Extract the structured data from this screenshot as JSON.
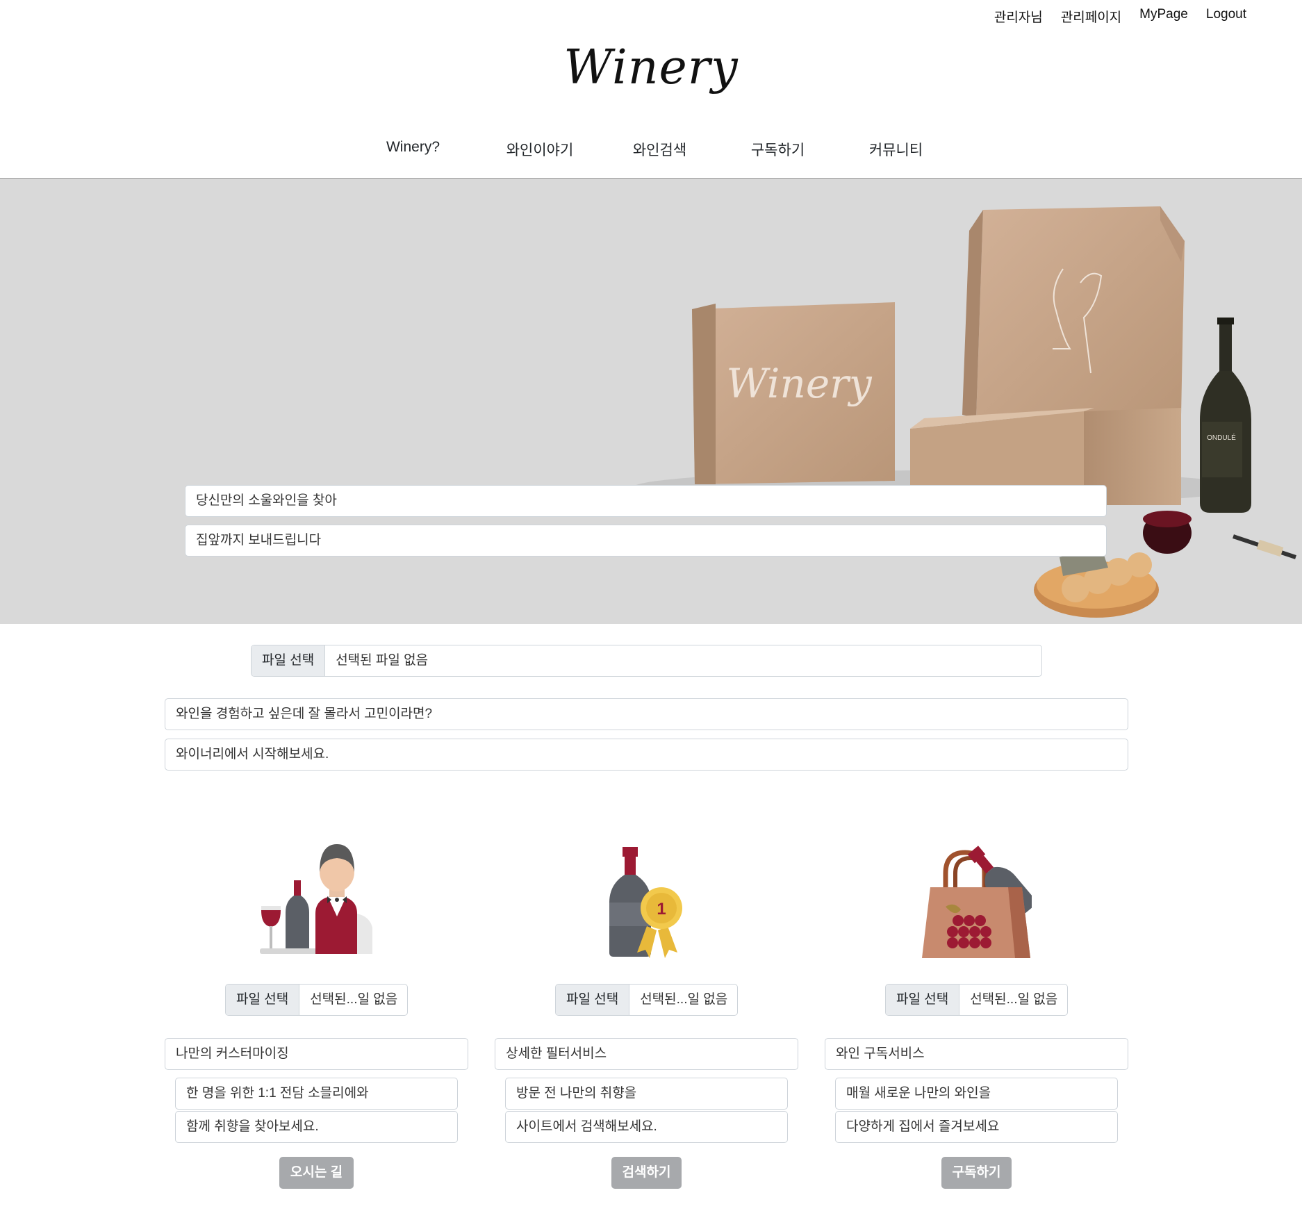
{
  "topbar": {
    "user": "관리자님",
    "admin": "관리페이지",
    "mypage": "MyPage",
    "logout": "Logout"
  },
  "logo": {
    "text": "Winery"
  },
  "nav": {
    "items": [
      "Winery?",
      "와인이야기",
      "와인검색",
      "구독하기",
      "커뮤니티"
    ]
  },
  "hero": {
    "line1": "당신만의 소울와인을 찾아",
    "line2": "집앞까지 보내드립니다",
    "box_print": "Winery",
    "bottle_label": "ONDULÉ"
  },
  "upload_main": {
    "button": "파일 선택",
    "status": "선택된 파일 없음"
  },
  "intro": {
    "line1": "와인을 경험하고 싶은데 잘 몰라서 고민이라면?",
    "line2": "와이너리에서 시작해보세요."
  },
  "features": [
    {
      "icon": "sommelier-icon",
      "file_button": "파일 선택",
      "file_status": "선택된...일 없음",
      "title": "나만의 커스터마이징",
      "desc1": "한 명을 위한 1:1 전담 소믈리에와",
      "desc2": "함께 취향을 찾아보세요.",
      "action": "오시는 길"
    },
    {
      "icon": "award-wine-icon",
      "file_button": "파일 선택",
      "file_status": "선택된...일 없음",
      "title": "상세한 필터서비스",
      "desc1": "방문 전 나만의 취향을",
      "desc2": "사이트에서 검색해보세요.",
      "action": "검색하기"
    },
    {
      "icon": "wine-bag-icon",
      "file_button": "파일 선택",
      "file_status": "선택된...일 없음",
      "title": "와인 구독서비스",
      "desc1": "매월 새로운 나만의 와인을",
      "desc2": "다양하게 집에서 즐겨보세요",
      "action": "구독하기"
    }
  ],
  "colors": {
    "wine": "#9c1a33",
    "hero_bg": "#d9d9d9",
    "button_gray": "#a7a9ac",
    "kraft": "#c9a88a"
  }
}
